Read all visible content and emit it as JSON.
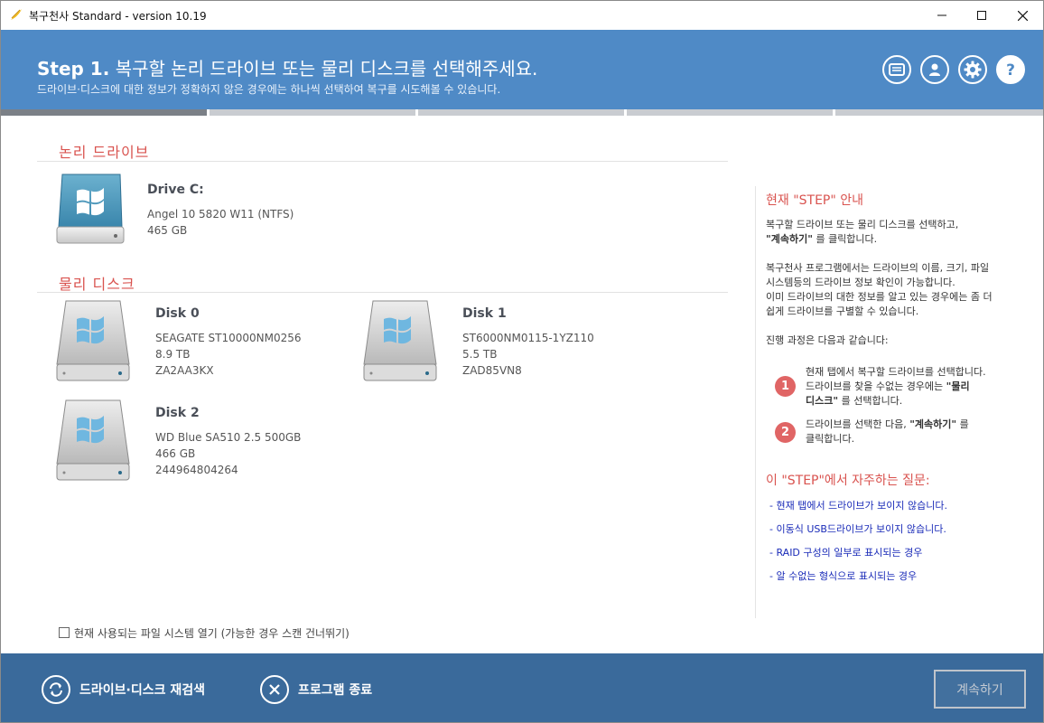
{
  "window": {
    "title": "복구천사 Standard - version 10.19"
  },
  "header": {
    "step_label": "Step 1.",
    "step_title": "복구할 논리 드라이브 또는 물리 디스크를 선택해주세요.",
    "subtitle": "드라이브·디스크에 대한 정보가 정확하지 않은 경우에는 하나씩 선택하여 복구를 시도해볼 수 있습니다.",
    "icons": [
      "monitor-icon",
      "user-icon",
      "gear-icon",
      "help-icon"
    ],
    "progress_fraction": 0.2
  },
  "logical": {
    "section_title": "논리 드라이브",
    "drives": [
      {
        "name": "Drive C:",
        "label": "Angel 10 5820 W11 (NTFS)",
        "size": "465 GB"
      }
    ]
  },
  "physical": {
    "section_title": "물리 디스크",
    "disks": [
      {
        "name": "Disk 0",
        "model": "SEAGATE ST10000NM0256",
        "size": "8.9 TB",
        "serial": "ZA2AA3KX"
      },
      {
        "name": "Disk 1",
        "model": "ST6000NM0115-1YZ110",
        "size": "5.5 TB",
        "serial": "ZAD85VN8"
      },
      {
        "name": "Disk 2",
        "model": "WD Blue SA510 2.5 500GB",
        "size": "466 GB",
        "serial": "244964804264"
      }
    ]
  },
  "guide": {
    "title": "현재 \"STEP\" 안내",
    "p1_line1": "복구할 드라이브 또는 물리 디스크를 선택하고,",
    "p1_bold": "\"계속하기\"",
    "p1_line2_rest": " 를 클릭합니다.",
    "p2_line1": "복구천사 프로그램에서는 드라이브의 이름, 크기, 파일",
    "p2_line2": "시스템등의 드라이브 정보 확인이 가능합니다.",
    "p2_line3": "이미 드라이브의 대한 정보를 알고 있는 경우에는 좀 더",
    "p2_line4": "쉽게 드라이브를 구별할 수 있습니다.",
    "p3": "진행 과정은 다음과 같습니다:",
    "step1_num": "1",
    "step1_line1": "현재 탭에서 복구할 드라이브를 선택합니다.",
    "step1_line2_pre": "드라이브를 찾을 수없는 경우에는 ",
    "step1_line2_bold": "\"물리",
    "step1_line3_bold": "디스크\"",
    "step1_line3_rest": " 를 선택합니다.",
    "step2_num": "2",
    "step2_line1_pre": "드라이브를 선택한 다음, ",
    "step2_line1_bold": "\"계속하기\"",
    "step2_line1_rest": " 를",
    "step2_line2": "클릭합니다."
  },
  "faq": {
    "title": "이 \"STEP\"에서 자주하는 질문:",
    "links": [
      "- 현재 탭에서 드라이브가 보이지 않습니다.",
      "- 이동식 USB드라이브가 보이지 않습니다.",
      "- RAID 구성의 일부로 표시되는 경우",
      "- 알 수없는 형식으로 표시되는 경우"
    ]
  },
  "options": {
    "open_fs_label": "현재 사용되는 파일 시스템 열기 (가능한 경우 스캔 건너뛰기)",
    "open_fs_checked": false
  },
  "footer": {
    "rescan_label": "드라이브·디스크 재검색",
    "exit_label": "프로그램 종료",
    "continue_label": "계속하기"
  },
  "colors": {
    "header_bg": "#4f8ac6",
    "footer_bg": "#3a6a9b",
    "accent_red": "#d9534f",
    "link_blue": "#1a2bb8"
  }
}
